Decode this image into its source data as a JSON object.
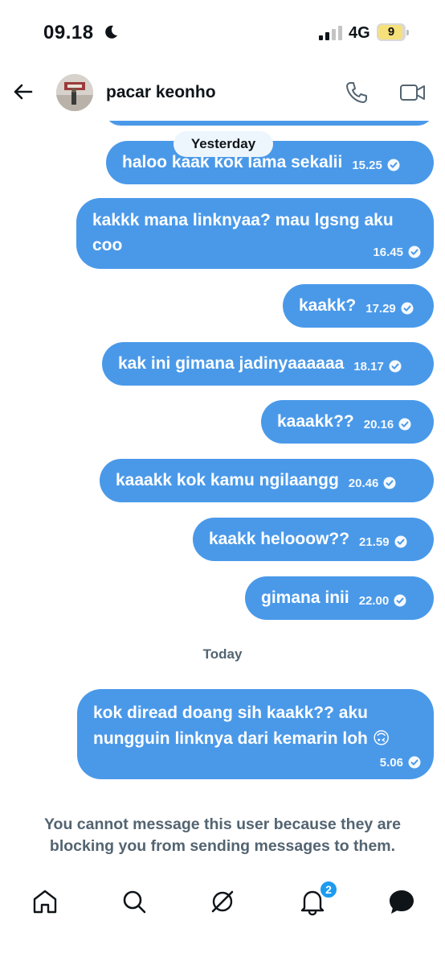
{
  "status_bar": {
    "time": "09.18",
    "network": "4G",
    "battery": "9"
  },
  "header": {
    "contact_name": "pacar keonho"
  },
  "chat": {
    "yesterday_label": "Yesterday",
    "today_label": "Today",
    "messages": [
      {
        "text": "haloo kaak kok lama sekalii",
        "time": "15.25"
      },
      {
        "text_line1": "kakkk mana linknyaa? mau lgsng aku",
        "text_line2": "coo",
        "time": "16.45"
      },
      {
        "text": "kaakk?",
        "time": "17.29"
      },
      {
        "text": "kak ini gimana jadinyaaaaaa",
        "time": "18.17"
      },
      {
        "text": "kaaakk??",
        "time": "20.16"
      },
      {
        "text": "kaaakk kok kamu ngilaangg",
        "time": "20.46"
      },
      {
        "text": "kaakk helooow??",
        "time": "21.59"
      },
      {
        "text": "gimana inii",
        "time": "22.00"
      },
      {
        "text_line1": "kok diread doang sih kaakk?? aku",
        "text_line2": "nungguin linknya dari kemarin loh",
        "emoji": "🙃",
        "time": "5.06"
      }
    ],
    "blocked_notice": "You cannot message this user because they are blocking you from sending messages to them."
  },
  "bottom_nav": {
    "notifications_badge": "2"
  },
  "colors": {
    "bubble": "#4a99e9",
    "badge": "#1d9bf0",
    "muted_text": "#536471"
  }
}
